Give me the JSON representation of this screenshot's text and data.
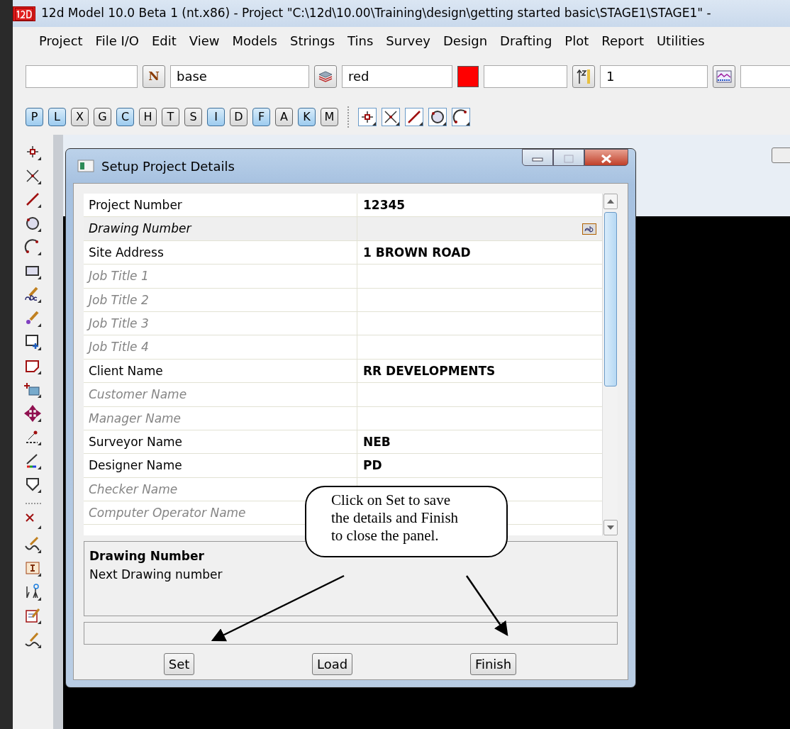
{
  "window": {
    "title": "12d Model 10.0 Beta 1 (nt.x86) - Project \"C:\\12d\\10.00\\Training\\design\\getting started basic\\STAGE1\\STAGE1\" -"
  },
  "menu": [
    {
      "label": "Project"
    },
    {
      "label": "File I/O"
    },
    {
      "label": "Edit"
    },
    {
      "label": "View"
    },
    {
      "label": "Models"
    },
    {
      "label": "Strings"
    },
    {
      "label": "Tins"
    },
    {
      "label": "Survey"
    },
    {
      "label": "Design"
    },
    {
      "label": "Drafting"
    },
    {
      "label": "Plot"
    },
    {
      "label": "Report"
    },
    {
      "label": "Utilities"
    }
  ],
  "toolbar": [
    {
      "kind": "field"
    },
    {
      "kind": "letter",
      "label": "N"
    },
    {
      "kind": "field",
      "value": "base"
    },
    {
      "kind": "layers"
    },
    {
      "kind": "field",
      "value": "red"
    },
    {
      "kind": "swatch",
      "color": "#ff0000"
    },
    {
      "kind": "field"
    },
    {
      "kind": "sort"
    },
    {
      "kind": "field",
      "value": "1"
    },
    {
      "kind": "profile"
    },
    {
      "kind": "field"
    }
  ],
  "letter_buttons": [
    {
      "label": "P",
      "on": true
    },
    {
      "label": "L",
      "on": true
    },
    {
      "label": "X",
      "on": false
    },
    {
      "label": "G",
      "on": false
    },
    {
      "label": "C",
      "on": true
    },
    {
      "label": "H",
      "on": false
    },
    {
      "label": "T",
      "on": false
    },
    {
      "label": "S",
      "on": false
    },
    {
      "label": "I",
      "on": true
    },
    {
      "label": "D",
      "on": false
    },
    {
      "label": "F",
      "on": true
    },
    {
      "label": "A",
      "on": false
    },
    {
      "label": "K",
      "on": true
    },
    {
      "label": "M",
      "on": false
    }
  ],
  "dialog": {
    "title": "Setup Project Details",
    "rows": [
      {
        "label": "Project Number",
        "value": "12345",
        "selected": false
      },
      {
        "label": "Drawing Number",
        "selected": true
      },
      {
        "label": "Site Address",
        "value": "1 BROWN ROAD",
        "selected": false
      },
      {
        "label": "Job Title 1",
        "selected": false
      },
      {
        "label": "Job Title 2",
        "selected": false
      },
      {
        "label": "Job Title 3",
        "selected": false
      },
      {
        "label": "Job Title 4",
        "selected": false
      },
      {
        "label": "Client Name",
        "value": "RR DEVELOPMENTS",
        "selected": false
      },
      {
        "label": "Customer Name",
        "selected": false
      },
      {
        "label": "Manager Name",
        "selected": false
      },
      {
        "label": "Surveyor Name",
        "value": "NEB",
        "selected": false
      },
      {
        "label": "Designer Name",
        "value": "PD",
        "selected": false
      },
      {
        "label": "Checker Name",
        "selected": false
      },
      {
        "label": "Computer Operator Name",
        "selected": false
      }
    ],
    "help": {
      "title": "Drawing Number",
      "text": "Next Drawing number"
    },
    "buttons": [
      "Set",
      "Load",
      "Finish"
    ]
  },
  "callout": {
    "lines": [
      "Click on Set to save",
      "the details and Finish",
      "to close the panel."
    ]
  }
}
